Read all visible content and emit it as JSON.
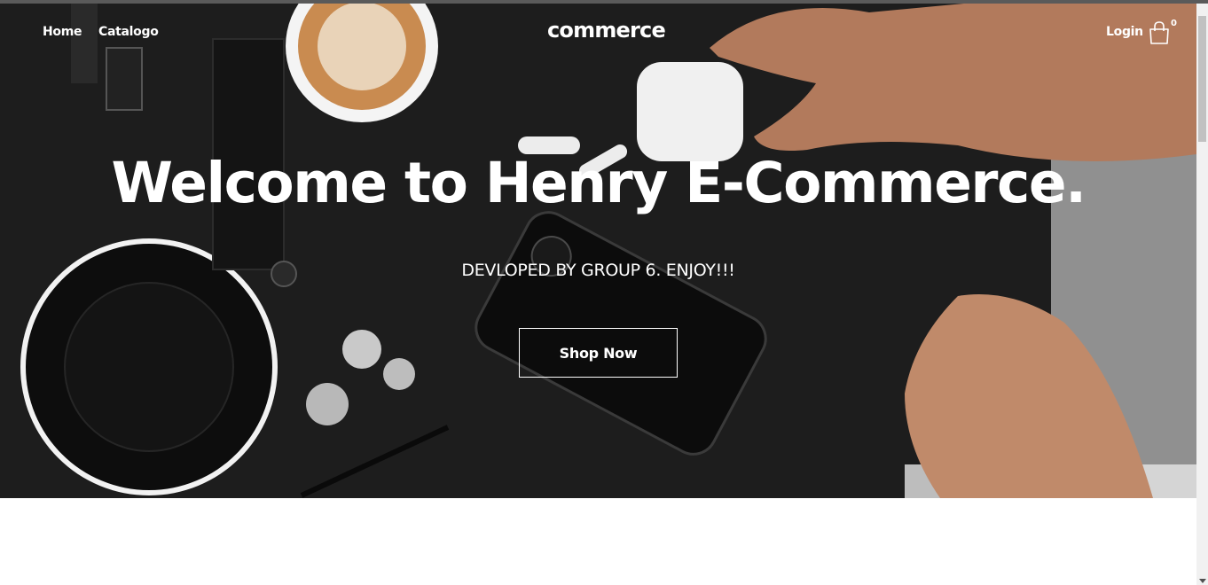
{
  "nav": {
    "home_label": "Home",
    "catalog_label": "Catalogo",
    "brand": "commerce",
    "login_label": "Login",
    "cart_count": "0"
  },
  "hero": {
    "title": "Welcome to Henry E-Commerce.",
    "subtitle": "DEVLOPED BY GROUP 6. ENJOY!!!",
    "cta_label": "Shop Now"
  },
  "icons": {
    "cart": "shopping-bag-icon"
  },
  "colors": {
    "hero_background": "#1e1e1e",
    "text": "#ffffff"
  }
}
